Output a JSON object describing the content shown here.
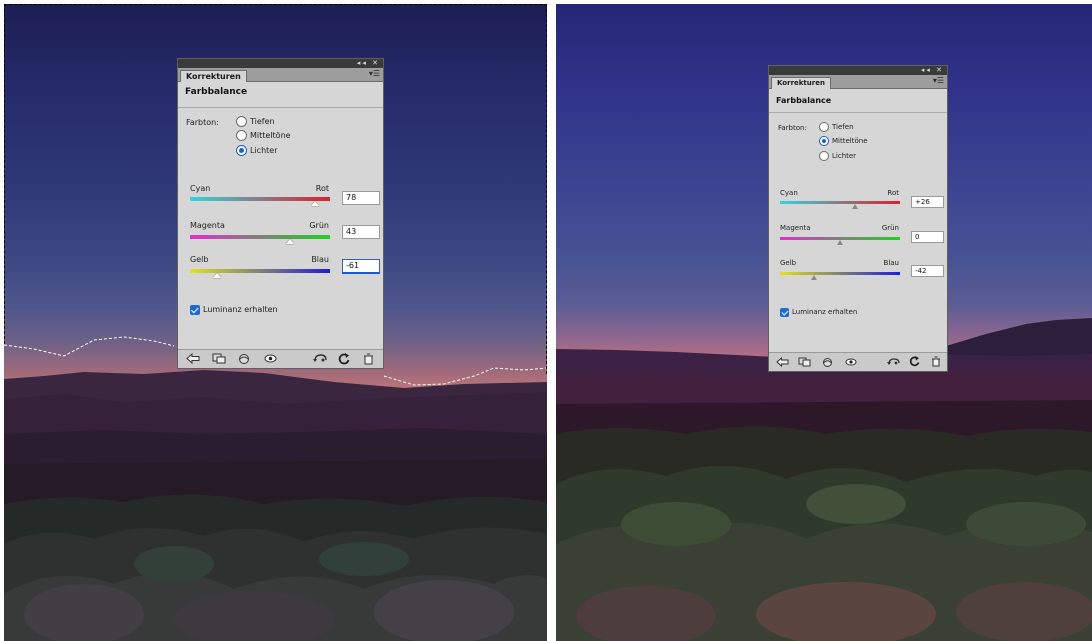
{
  "panels": {
    "left": {
      "tab": "Korrekturen",
      "title": "Farbbalance",
      "tone_label": "Farbton:",
      "tones": [
        "Tiefen",
        "Mitteltöne",
        "Lichter"
      ],
      "selected_tone": "Lichter",
      "sliders": [
        {
          "left": "Cyan",
          "right": "Rot",
          "value": "78"
        },
        {
          "left": "Magenta",
          "right": "Grün",
          "value": "43"
        },
        {
          "left": "Gelb",
          "right": "Blau",
          "value": "-61"
        }
      ],
      "luminance": "Luminanz erhalten",
      "luminance_checked": true
    },
    "right": {
      "tab": "Korrekturen",
      "title": "Farbbalance",
      "tone_label": "Farbton:",
      "tones": [
        "Tiefen",
        "Mitteltöne",
        "Lichter"
      ],
      "selected_tone": "Mitteltöne",
      "sliders": [
        {
          "left": "Cyan",
          "right": "Rot",
          "value": "+26"
        },
        {
          "left": "Magenta",
          "right": "Grün",
          "value": "0"
        },
        {
          "left": "Gelb",
          "right": "Blau",
          "value": "-42"
        }
      ],
      "luminance": "Luminanz erhalten",
      "luminance_checked": true
    }
  },
  "slider_levels": {
    "left": [
      78,
      43,
      -61
    ],
    "right": [
      26,
      0,
      -42
    ],
    "range": [
      -100,
      100
    ]
  },
  "colors": {
    "cyan": "#2fd7e0",
    "red": "#e0202a",
    "magenta": "#e22ed2",
    "green": "#1ed31e",
    "yellow": "#e2e21a",
    "blue": "#1d1dd8",
    "accent": "#1e6ad2"
  },
  "icons": [
    "back-arrow-icon",
    "clip-to-layer-icon",
    "view-previous-icon",
    "visibility-eye-icon",
    "reset-icon",
    "refresh-icon",
    "trash-icon"
  ]
}
